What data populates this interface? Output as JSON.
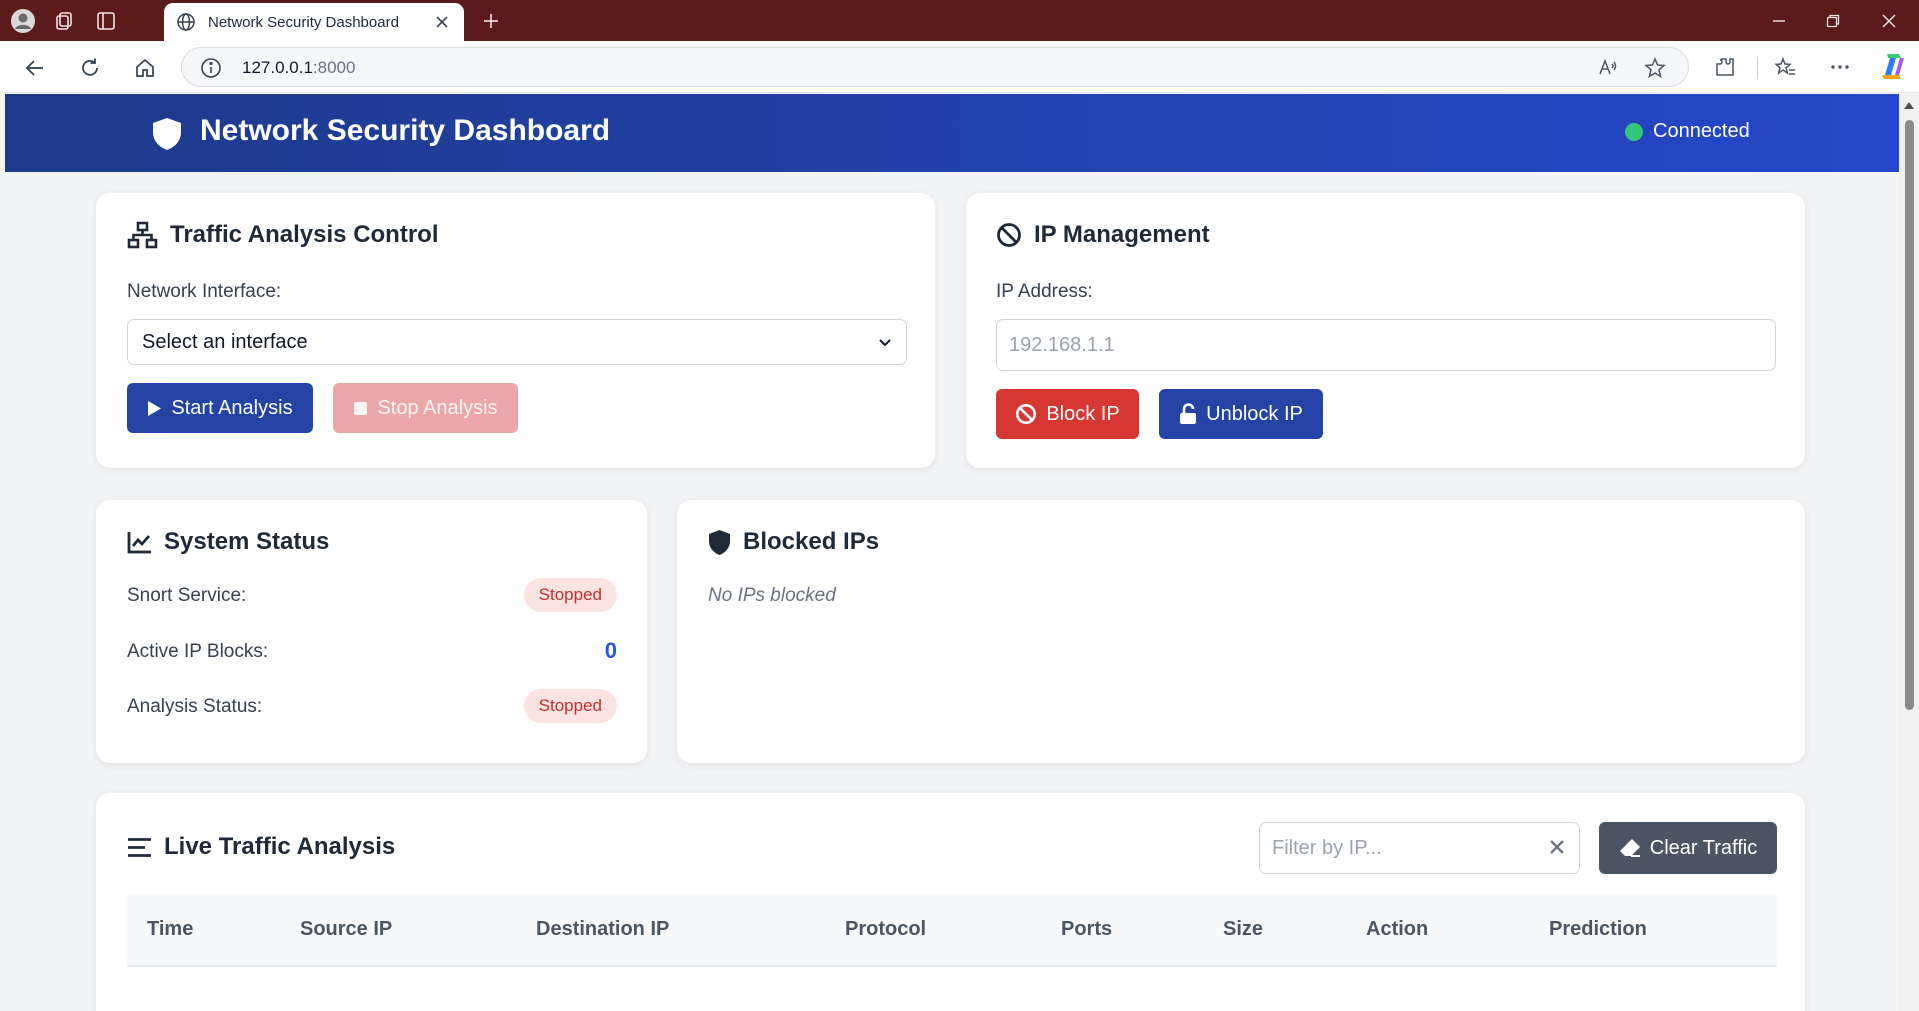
{
  "browser": {
    "tab_title": "Network Security Dashboard",
    "url_host": "127.0.0.1",
    "url_port": ":8000"
  },
  "header": {
    "title": "Network Security Dashboard",
    "connection_status": "Connected",
    "status_color": "#34c779"
  },
  "traffic_control": {
    "title": "Traffic Analysis Control",
    "interface_label": "Network Interface:",
    "interface_selected": "Select an interface",
    "start_label": "Start Analysis",
    "stop_label": "Stop Analysis"
  },
  "ip_management": {
    "title": "IP Management",
    "ip_label": "IP Address:",
    "ip_placeholder": "192.168.1.1",
    "block_label": "Block IP",
    "unblock_label": "Unblock IP"
  },
  "system_status": {
    "title": "System Status",
    "snort_label": "Snort Service:",
    "snort_value": "Stopped",
    "active_blocks_label": "Active IP Blocks:",
    "active_blocks_value": "0",
    "analysis_label": "Analysis Status:",
    "analysis_value": "Stopped"
  },
  "blocked_ips": {
    "title": "Blocked IPs",
    "empty_text": "No IPs blocked"
  },
  "live_traffic": {
    "title": "Live Traffic Analysis",
    "filter_placeholder": "Filter by IP...",
    "clear_label": "Clear Traffic",
    "columns": [
      "Time",
      "Source IP",
      "Destination IP",
      "Protocol",
      "Ports",
      "Size",
      "Action",
      "Prediction"
    ]
  },
  "colors": {
    "header_start": "#1e3a8a",
    "header_end": "#2647c8",
    "primary": "#2443a4",
    "danger": "#d73732",
    "muted_danger": "#eba7a7",
    "neutral": "#4b5563",
    "stopped_bg": "#fde2e2",
    "stopped_text": "#c2302d",
    "count": "#2a55d8"
  },
  "icons": [
    "profile-icon",
    "workspaces-icon",
    "tab-actions-icon",
    "globe-icon",
    "close-icon",
    "plus-icon",
    "minimize-icon",
    "maximize-icon",
    "back-icon",
    "refresh-icon",
    "home-icon",
    "info-icon",
    "read-aloud-icon",
    "star-icon",
    "extensions-icon",
    "favorites-icon",
    "more-icon",
    "copilot-icon",
    "shield-icon",
    "sitemap-icon",
    "ban-icon",
    "chart-line-icon",
    "bars-icon",
    "play-icon",
    "stop-icon",
    "lock-open-icon",
    "eraser-icon"
  ]
}
